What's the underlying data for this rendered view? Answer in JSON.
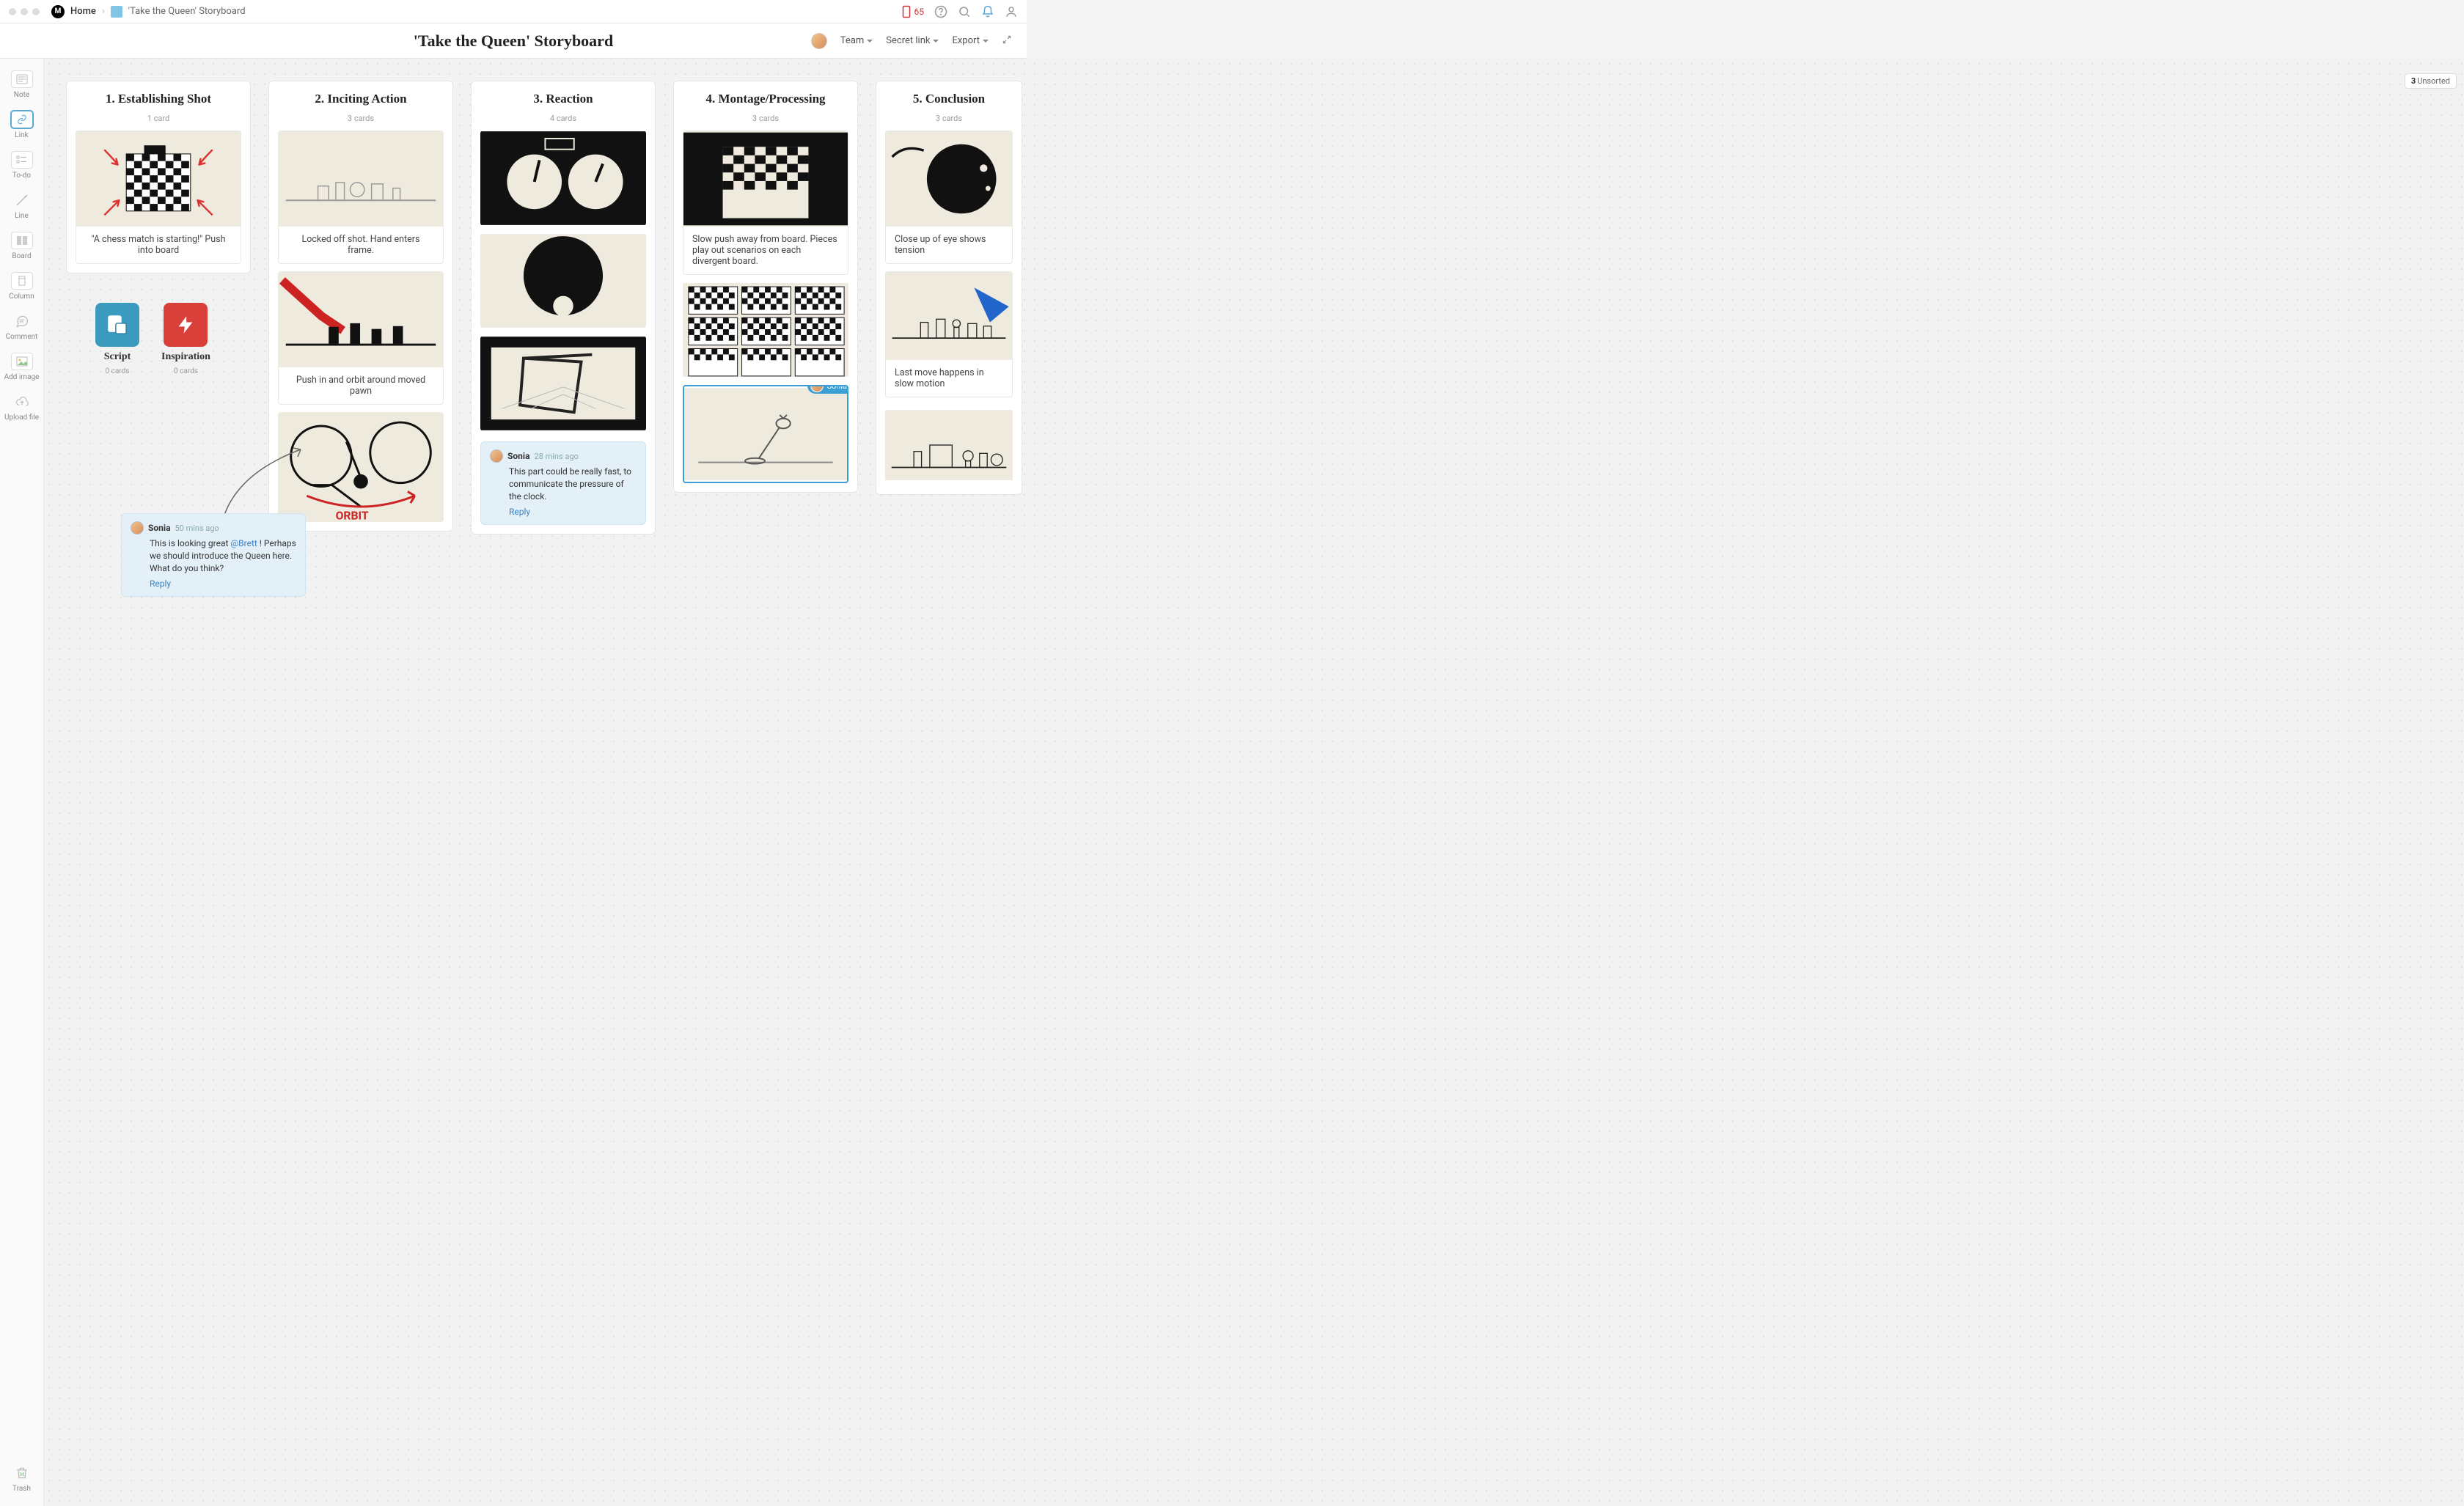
{
  "breadcrumb": {
    "home": "Home",
    "title": "'Take the Queen' Storyboard"
  },
  "titlebar": {
    "notif_count": "65"
  },
  "header": {
    "title": "'Take the Queen' Storyboard",
    "team_label": "Team",
    "secret_link_label": "Secret link",
    "export_label": "Export"
  },
  "sidebar": {
    "tools": {
      "note": "Note",
      "link": "Link",
      "todo": "To-do",
      "line": "Line",
      "board": "Board",
      "column": "Column",
      "comment": "Comment",
      "add_image": "Add image",
      "upload_file": "Upload file",
      "trash": "Trash"
    }
  },
  "unsorted": {
    "count": "3",
    "label": "Unsorted"
  },
  "columns": [
    {
      "title": "1. Establishing Shot",
      "count": "1 card",
      "cards": [
        {
          "caption": "\"A chess match is starting!\" Push into board"
        }
      ]
    },
    {
      "title": "2. Inciting Action",
      "count": "3 cards",
      "cards": [
        {
          "caption": "Locked off shot. Hand enters frame."
        },
        {
          "caption": "Push in and orbit around moved pawn"
        },
        {
          "caption": ""
        }
      ]
    },
    {
      "title": "3. Reaction",
      "count": "4 cards",
      "cards": [
        {
          "caption": ""
        },
        {
          "caption": ""
        },
        {
          "caption": ""
        }
      ],
      "comment": {
        "author": "Sonia",
        "time": "28 mins ago",
        "body": "This part could be really fast, to communicate the pressure of the clock.",
        "reply": "Reply"
      }
    },
    {
      "title": "4. Montage/Processing",
      "count": "3 cards",
      "cards": [
        {
          "caption": "Slow push away from board. Pieces play out scenarios on each divergent board."
        },
        {
          "caption": ""
        },
        {
          "caption": ""
        }
      ],
      "presence": {
        "name": "Sonia"
      }
    },
    {
      "title": "5. Conclusion",
      "count": "3 cards",
      "cards": [
        {
          "caption": "Close up of eye shows tension"
        },
        {
          "caption": "Last move happens in slow motion"
        },
        {
          "caption": ""
        }
      ]
    }
  ],
  "extra_tiles": {
    "script": {
      "title": "Script",
      "count": "0 cards"
    },
    "inspiration": {
      "title": "Inspiration",
      "count": "0 cards"
    }
  },
  "floating_comment": {
    "author": "Sonia",
    "time": "50 mins ago",
    "body_pre": "This is looking great ",
    "mention": "@Brett",
    "body_post": " ! Perhaps we should introduce the Queen here. What do you think?",
    "reply": "Reply"
  }
}
